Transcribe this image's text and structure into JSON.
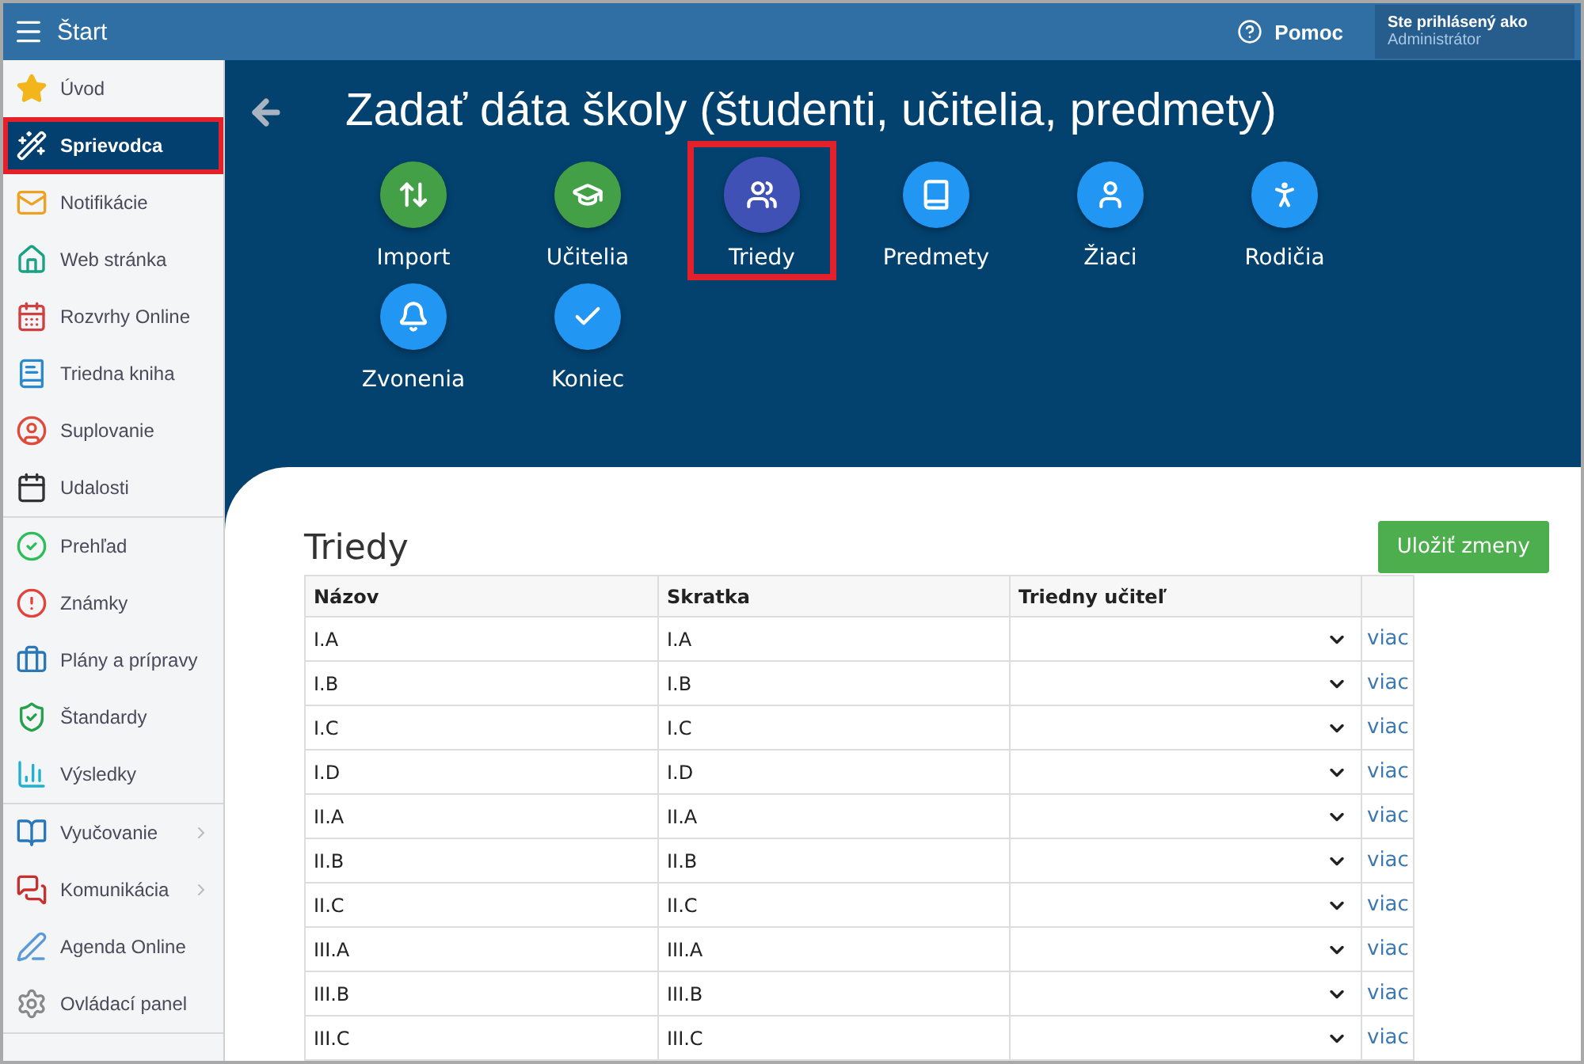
{
  "topbar": {
    "menu_label": "Štart",
    "help": "Pomoc",
    "user_caption": "Ste prihlásený ako",
    "user_name": "Administrátor"
  },
  "sidebar": {
    "groups": [
      {
        "items": [
          {
            "label": "Úvod",
            "selected": false,
            "highlighted": false,
            "expandable": false
          },
          {
            "label": "Sprievodca",
            "selected": true,
            "highlighted": true,
            "expandable": false
          },
          {
            "label": "Notifikácie",
            "selected": false,
            "highlighted": false,
            "expandable": false
          },
          {
            "label": "Web stránka",
            "selected": false,
            "highlighted": false,
            "expandable": false
          },
          {
            "label": "Rozvrhy Online",
            "selected": false,
            "highlighted": false,
            "expandable": false
          },
          {
            "label": "Triedna kniha",
            "selected": false,
            "highlighted": false,
            "expandable": false
          },
          {
            "label": "Suplovanie",
            "selected": false,
            "highlighted": false,
            "expandable": false
          },
          {
            "label": "Udalosti",
            "selected": false,
            "highlighted": false,
            "expandable": false
          }
        ]
      },
      {
        "items": [
          {
            "label": "Prehľad",
            "selected": false,
            "highlighted": false,
            "expandable": false
          },
          {
            "label": "Známky",
            "selected": false,
            "highlighted": false,
            "expandable": false
          },
          {
            "label": "Plány a prípravy",
            "selected": false,
            "highlighted": false,
            "expandable": false
          },
          {
            "label": "Štandardy",
            "selected": false,
            "highlighted": false,
            "expandable": false
          },
          {
            "label": "Výsledky",
            "selected": false,
            "highlighted": false,
            "expandable": false
          }
        ]
      },
      {
        "items": [
          {
            "label": "Vyučovanie",
            "selected": false,
            "highlighted": false,
            "expandable": true
          },
          {
            "label": "Komunikácia",
            "selected": false,
            "highlighted": false,
            "expandable": true
          },
          {
            "label": "Agenda Online",
            "selected": false,
            "highlighted": false,
            "expandable": false
          },
          {
            "label": "Ovládací panel",
            "selected": false,
            "highlighted": false,
            "expandable": false
          }
        ]
      }
    ]
  },
  "page": {
    "title": "Zadať dáta školy (študenti, učitelia, predmety)"
  },
  "steps": [
    {
      "label": "Import",
      "done": true,
      "selected": false,
      "highlighted": false
    },
    {
      "label": "Učitelia",
      "done": true,
      "selected": false,
      "highlighted": false
    },
    {
      "label": "Triedy",
      "done": false,
      "selected": true,
      "highlighted": true
    },
    {
      "label": "Predmety",
      "done": false,
      "selected": false,
      "highlighted": false
    },
    {
      "label": "Žiaci",
      "done": false,
      "selected": false,
      "highlighted": false
    },
    {
      "label": "Rodičia",
      "done": false,
      "selected": false,
      "highlighted": false
    },
    {
      "label": "Zvonenia",
      "done": false,
      "selected": false,
      "highlighted": false
    },
    {
      "label": "Koniec",
      "done": false,
      "selected": false,
      "highlighted": false
    }
  ],
  "section": {
    "title": "Triedy",
    "save_button": "Uložiť zmeny"
  },
  "table": {
    "columns": [
      "Názov",
      "Skratka",
      "Triedny učiteľ"
    ],
    "rows": [
      {
        "name": "I.A",
        "short": "I.A",
        "more": "viac"
      },
      {
        "name": "I.B",
        "short": "I.B",
        "more": "viac"
      },
      {
        "name": "I.C",
        "short": "I.C",
        "more": "viac"
      },
      {
        "name": "I.D",
        "short": "I.D",
        "more": "viac"
      },
      {
        "name": "II.A",
        "short": "II.A",
        "more": "viac"
      },
      {
        "name": "II.B",
        "short": "II.B",
        "more": "viac"
      },
      {
        "name": "II.C",
        "short": "II.C",
        "more": "viac"
      },
      {
        "name": "III.A",
        "short": "III.A",
        "more": "viac"
      },
      {
        "name": "III.B",
        "short": "III.B",
        "more": "viac"
      },
      {
        "name": "III.C",
        "short": "III.C",
        "more": "viac"
      }
    ]
  }
}
